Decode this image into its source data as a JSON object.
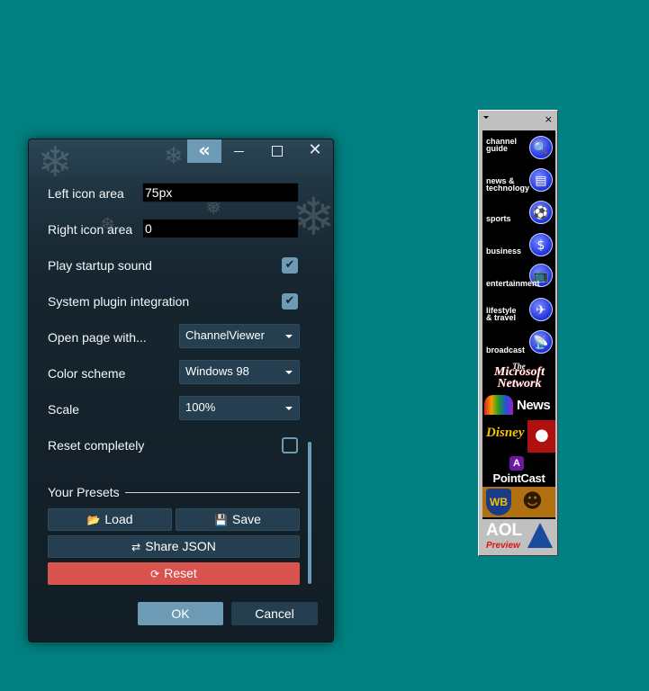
{
  "settings": {
    "left_icon_area": {
      "label": "Left icon area",
      "value": "75px"
    },
    "right_icon_area": {
      "label": "Right icon area",
      "value": "0"
    },
    "play_startup_sound": {
      "label": "Play startup sound",
      "checked": true
    },
    "system_plugin_integration": {
      "label": "System plugin integration",
      "checked": true
    },
    "open_page_with": {
      "label": "Open page with...",
      "value": "ChannelViewer"
    },
    "color_scheme": {
      "label": "Color scheme",
      "value": "Windows 98"
    },
    "scale": {
      "label": "Scale",
      "value": "100%"
    },
    "reset_completely": {
      "label": "Reset completely",
      "checked": false
    }
  },
  "presets": {
    "title": "Your Presets",
    "load_label": "Load",
    "save_label": "Save",
    "share_label": "Share JSON",
    "reset_label": "Reset"
  },
  "footer": {
    "ok_label": "OK",
    "cancel_label": "Cancel"
  },
  "channel_bar": {
    "close_glyph": "×",
    "channels": [
      {
        "label": "channel\nguide",
        "icon": "magnifier-icon"
      },
      {
        "label": "news &\ntechnology",
        "icon": "newspaper-icon"
      },
      {
        "label": "sports",
        "icon": "ball-icon"
      },
      {
        "label": "business",
        "icon": "dollar-icon"
      },
      {
        "label": "entertainment",
        "icon": "tv-icon"
      },
      {
        "label": "lifestyle\n& travel",
        "icon": "airplane-icon"
      },
      {
        "label": "broadcast",
        "icon": "broadcast-icon"
      }
    ],
    "msn_line1": "The",
    "msn_line2": "Microsoft Network",
    "news_label": "News",
    "disney_label": "Disney",
    "pointcast_label": "PointCast",
    "aol_label": "AOL",
    "aol_sub": "Preview"
  },
  "colors": {
    "desktop": "#008080",
    "accent": "#6d9bb5",
    "reset": "#d9534f",
    "dialog_bg": "#16252f"
  }
}
